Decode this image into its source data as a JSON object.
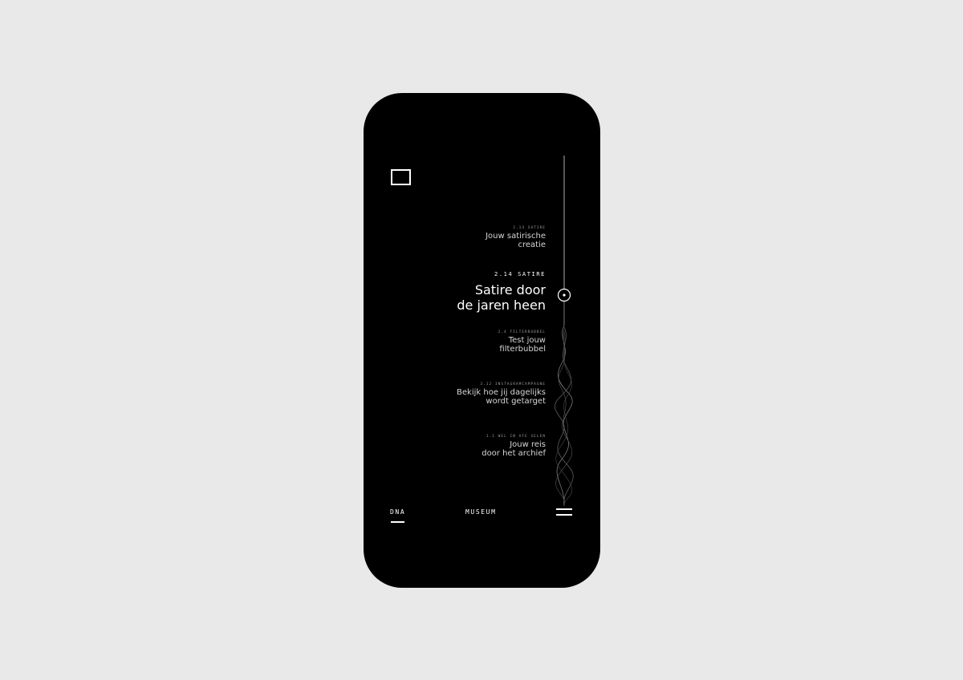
{
  "timeline_items": [
    {
      "tag": "2.14 SATIRE",
      "title_line1": "Jouw satirische",
      "title_line2": "creatie"
    },
    {
      "tag": "2.14 SATIRE",
      "title_line1": "Satire door",
      "title_line2": "de jaren heen"
    },
    {
      "tag": "2.4 FILTERBUBBEL",
      "title_line1": "Test jouw",
      "title_line2": "filterbubbel"
    },
    {
      "tag": "3.12 INSTAGRAMCAMPAGNE",
      "title_line1": "Bekijk hoe jij dagelijks",
      "title_line2": "wordt getarget"
    },
    {
      "tag": "1.1 WEL IN AFE SELEN",
      "title_line1": "Jouw reis",
      "title_line2": "door het archief"
    }
  ],
  "bottom_nav": {
    "left_label": "DNA",
    "center_label": "MUSEUM"
  },
  "colors": {
    "background": "#e9e9e9",
    "phone": "#000000",
    "foreground": "#ffffff"
  },
  "icons": {
    "logo": "frame-logo-icon",
    "menu": "menu-icon",
    "current_position": "timeline-marker-icon"
  }
}
